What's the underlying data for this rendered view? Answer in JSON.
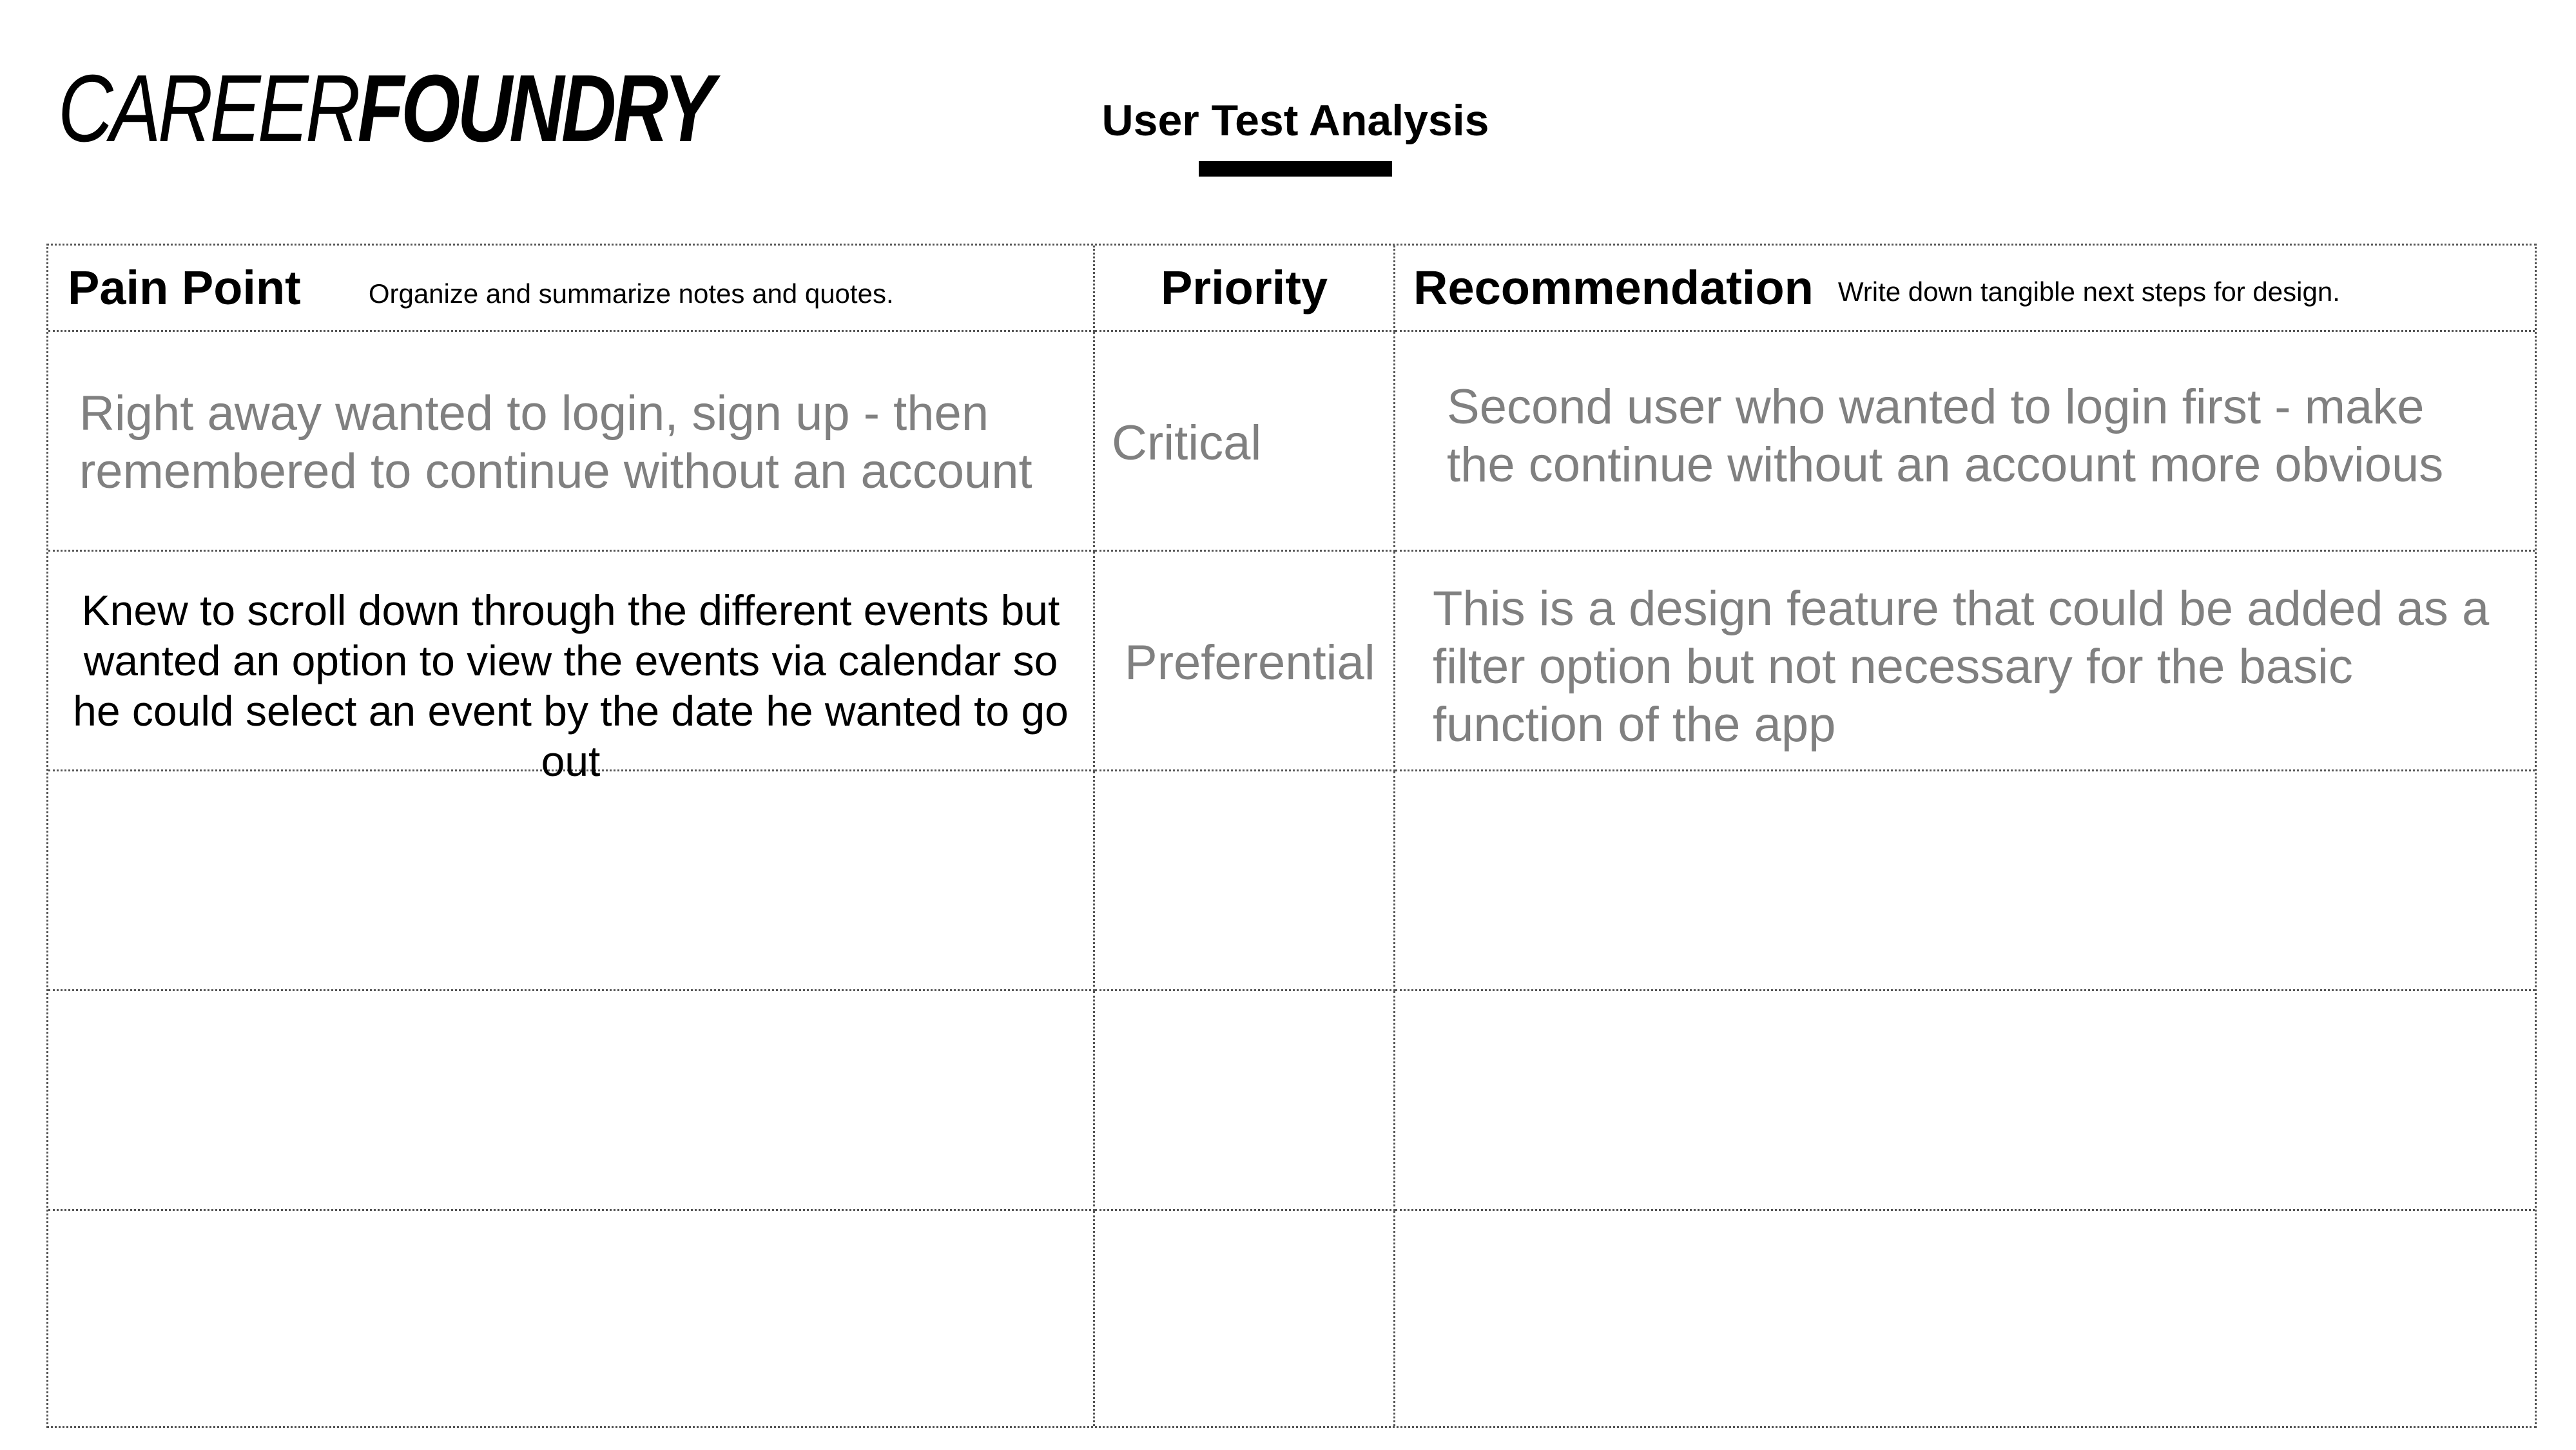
{
  "brand": {
    "logo_light": "CAREER",
    "logo_bold": "FOUNDRY"
  },
  "page": {
    "title": "User Test Analysis"
  },
  "table": {
    "headers": {
      "pain_point": "Pain Point",
      "pain_point_hint": "Organize and summarize notes and quotes.",
      "priority": "Priority",
      "recommendation": "Recommendation",
      "recommendation_hint": "Write down tangible next steps for design."
    },
    "rows": [
      {
        "pain_point": "Right away wanted to login, sign up - then remembered to continue without an account",
        "priority": "Critical",
        "recommendation": "Second user who wanted to login first - make the continue without an account more obvious"
      },
      {
        "pain_point": "Knew to scroll down through the different events but wanted an option to view the events via calendar so he could select an event by the date he wanted to go out",
        "priority": "Preferential",
        "recommendation": "This is a design feature that could be added as a filter option but not necessary for the basic function of the app"
      },
      {
        "pain_point": "",
        "priority": "",
        "recommendation": ""
      },
      {
        "pain_point": "",
        "priority": "",
        "recommendation": ""
      },
      {
        "pain_point": "",
        "priority": "",
        "recommendation": ""
      }
    ]
  },
  "colors": {
    "placeholder_text": "#808080",
    "grid_line": "#555555",
    "title_underline": "#000000"
  }
}
